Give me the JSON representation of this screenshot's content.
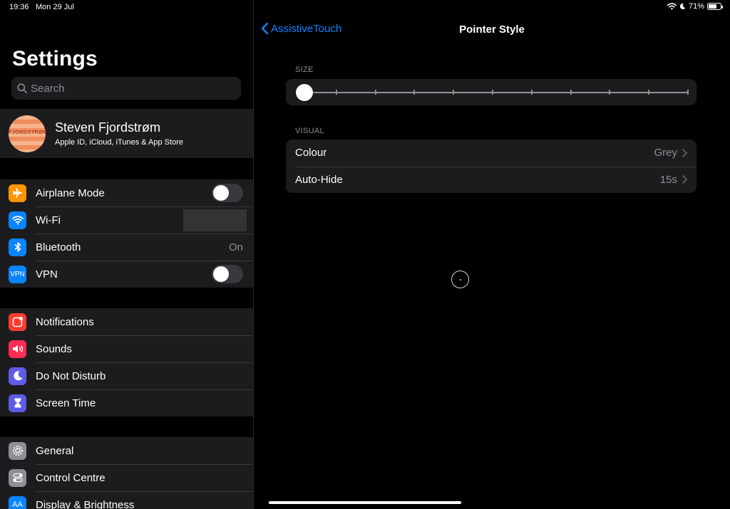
{
  "status": {
    "time": "19:36",
    "date": "Mon 29 Jul",
    "battery": "71%",
    "battery_level": 0.71
  },
  "sidebar": {
    "title": "Settings",
    "search_placeholder": "Search",
    "profile": {
      "name": "Steven Fjordstrøm",
      "subtitle": "Apple ID, iCloud, iTunes & App Store",
      "avatar_text": "FJORDSTRØM"
    },
    "group1": [
      {
        "label": "Airplane Mode",
        "icon": "airplane-icon",
        "color": "#ff9500",
        "toggle": false
      },
      {
        "label": "Wi-Fi",
        "icon": "wifi-icon",
        "color": "#0a84ff"
      },
      {
        "label": "Bluetooth",
        "icon": "bluetooth-icon",
        "color": "#0a84ff",
        "value": "On"
      },
      {
        "label": "VPN",
        "icon": "vpn-icon",
        "color": "#0a84ff",
        "icon_text": "VPN",
        "toggle": false
      }
    ],
    "group2": [
      {
        "label": "Notifications",
        "icon": "notifications-icon",
        "color": "#ff3b30"
      },
      {
        "label": "Sounds",
        "icon": "sounds-icon",
        "color": "#ff2d55"
      },
      {
        "label": "Do Not Disturb",
        "icon": "moon-icon",
        "color": "#5e5ce6"
      },
      {
        "label": "Screen Time",
        "icon": "hourglass-icon",
        "color": "#5e5ce6"
      }
    ],
    "group3": [
      {
        "label": "General",
        "icon": "gear-icon",
        "color": "#8e8e93"
      },
      {
        "label": "Control Centre",
        "icon": "switches-icon",
        "color": "#8e8e93"
      },
      {
        "label": "Display & Brightness",
        "icon": "text-size-icon",
        "color": "#0a84ff",
        "icon_text": "AA"
      }
    ]
  },
  "detail": {
    "back_label": "AssistiveTouch",
    "title": "Pointer Style",
    "size_header": "SIZE",
    "size_level": 0,
    "visual_header": "VISUAL",
    "rows": [
      {
        "label": "Colour",
        "value": "Grey"
      },
      {
        "label": "Auto-Hide",
        "value": "15s"
      }
    ]
  }
}
